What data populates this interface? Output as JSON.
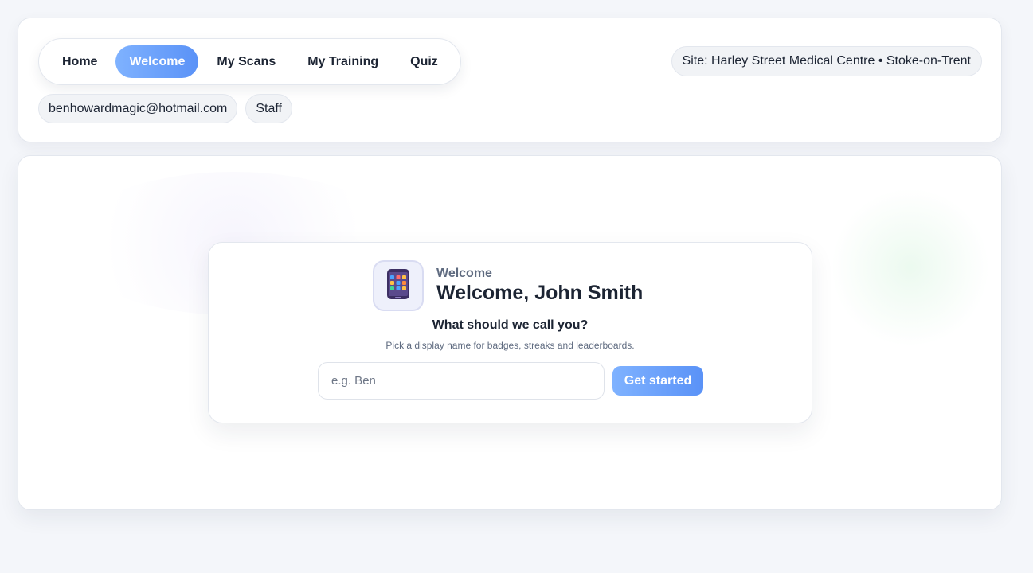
{
  "nav": {
    "items": [
      {
        "label": "Home",
        "active": false
      },
      {
        "label": "Welcome",
        "active": true
      },
      {
        "label": "My Scans",
        "active": false
      },
      {
        "label": "My Training",
        "active": false
      },
      {
        "label": "Quiz",
        "active": false
      }
    ]
  },
  "site": {
    "label": "Site: Harley Street Medical Centre • Stoke-on-Trent"
  },
  "user": {
    "email": "benhowardmagic@hotmail.com",
    "role": "Staff"
  },
  "welcome": {
    "eyebrow": "Welcome",
    "title": "Welcome, John Smith",
    "question": "What should we call you?",
    "hint": "Pick a display name for badges, streaks and leaderboards.",
    "input_placeholder": "e.g. Ben",
    "input_value": "",
    "button_label": "Get started",
    "logo_icon": "tablet-app-grid-icon"
  },
  "colors": {
    "accent": "#5a92f7",
    "accent_light": "#7fb2ff",
    "text": "#1c2433",
    "muted": "#5f6b80"
  }
}
